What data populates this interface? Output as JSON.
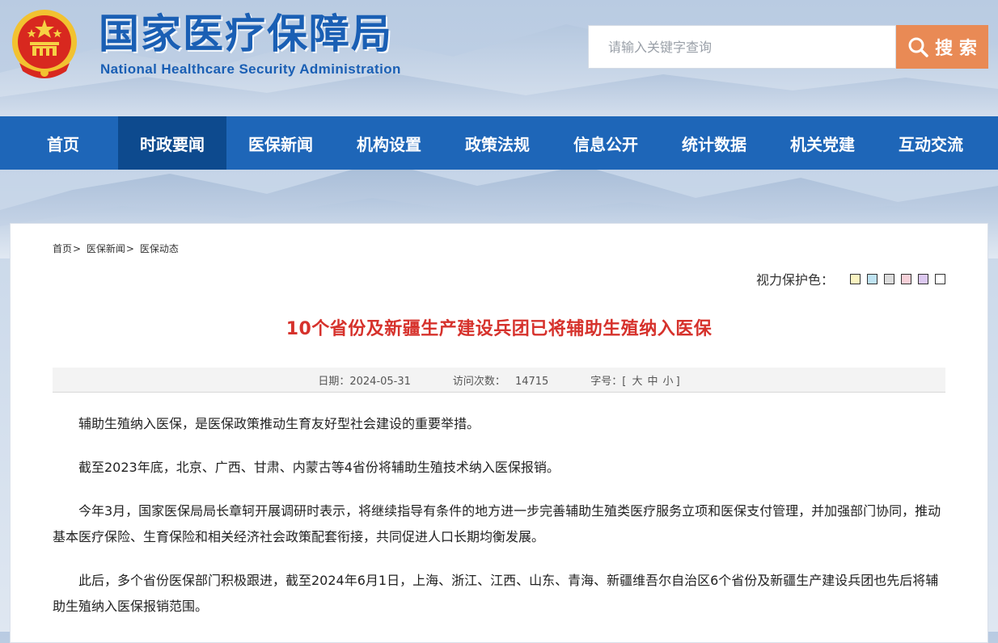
{
  "header": {
    "title_cn": "国家医疗保障局",
    "title_en": "National Healthcare Security Administration",
    "emblem_icon": "national-emblem-icon",
    "search": {
      "placeholder": "请输入关键字查询",
      "button_label": "搜 索",
      "button_icon": "search-icon"
    }
  },
  "nav": {
    "items": [
      {
        "label": "首页"
      },
      {
        "label": "时政要闻"
      },
      {
        "label": "医保新闻"
      },
      {
        "label": "机构设置"
      },
      {
        "label": "政策法规"
      },
      {
        "label": "信息公开"
      },
      {
        "label": "统计数据"
      },
      {
        "label": "机关党建"
      },
      {
        "label": "互动交流"
      }
    ],
    "active_index": 1
  },
  "breadcrumb": {
    "items": [
      "首页",
      "医保新闻",
      "医保动态"
    ],
    "separator": ">"
  },
  "eye_care": {
    "label": "视力保护色：",
    "swatches": [
      "#fbf4c1",
      "#bfe3f2",
      "#dcdcdc",
      "#f6d0d8",
      "#dcc8f0",
      "#ffffff"
    ]
  },
  "article": {
    "title": "10个省份及新疆生产建设兵团已将辅助生殖纳入医保",
    "meta": {
      "date_label": "日期：",
      "date": "2024-05-31",
      "visits_label": "访问次数：",
      "visits": "14715",
      "font_size_label": "字号：[",
      "font_large": "大",
      "font_medium": "中",
      "font_small": "小",
      "font_size_end": "]"
    },
    "paragraphs": [
      "辅助生殖纳入医保，是医保政策推动生育友好型社会建设的重要举措。",
      "截至2023年底，北京、广西、甘肃、内蒙古等4省份将辅助生殖技术纳入医保报销。",
      "今年3月，国家医保局局长章轲开展调研时表示，将继续指导有条件的地方进一步完善辅助生殖类医疗服务立项和医保支付管理，并加强部门协同，推动基本医疗保险、生育保险和相关经济社会政策配套衔接，共同促进人口长期均衡发展。",
      "此后，多个省份医保部门积极跟进，截至2024年6月1日，上海、浙江、江西、山东、青海、新疆维吾尔自治区6个省份及新疆生产建设兵团也先后将辅助生殖纳入医保报销范围。"
    ]
  },
  "colors": {
    "brand_blue": "#1e66b8",
    "nav_active": "#0d4a8e",
    "search_button": "#e98a55",
    "title_red": "#d6322c"
  }
}
